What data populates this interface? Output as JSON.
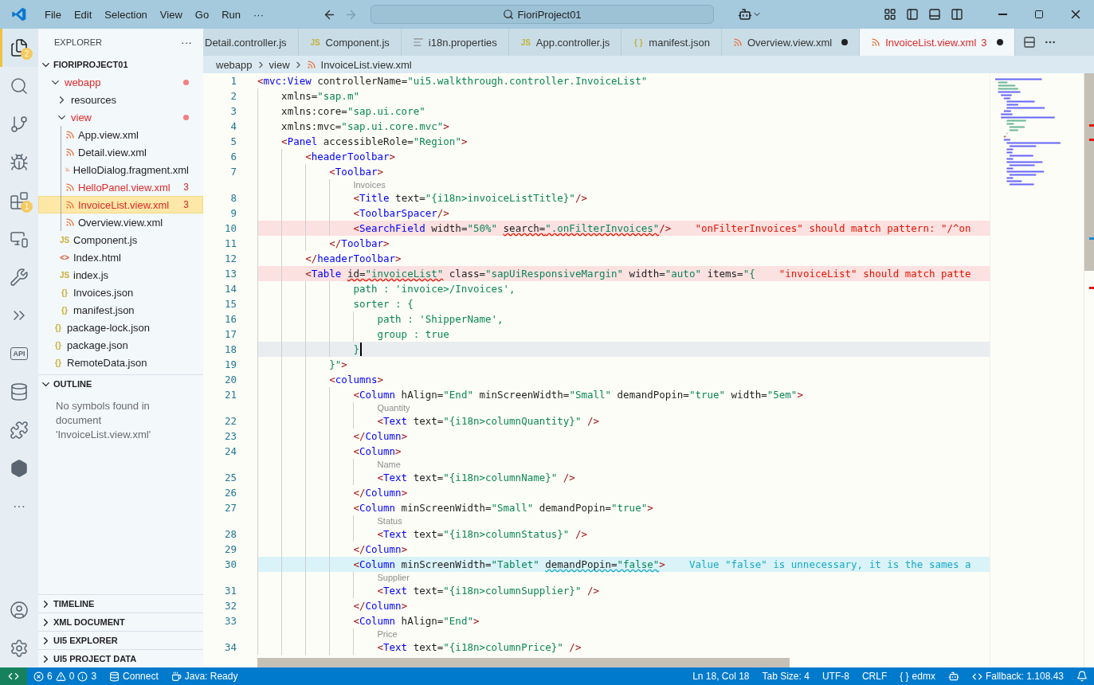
{
  "title_bar": {
    "menu": [
      "File",
      "Edit",
      "Selection",
      "View",
      "Go",
      "Run",
      "···"
    ],
    "command_center": {
      "value": "FioriProject01"
    }
  },
  "activity_bar": {
    "items": [
      {
        "kind": "files",
        "selected": true,
        "badge": "2"
      },
      {
        "kind": "search",
        "selected": false
      },
      {
        "kind": "source-control",
        "selected": false
      },
      {
        "kind": "run-debug",
        "selected": false
      },
      {
        "kind": "extensions",
        "selected": false,
        "badge": "1"
      },
      {
        "kind": "remote",
        "selected": false
      },
      {
        "kind": "tools",
        "selected": false
      },
      {
        "kind": "chevrons",
        "selected": false
      },
      {
        "kind": "api",
        "selected": false,
        "label": "API"
      },
      {
        "kind": "database",
        "selected": false
      },
      {
        "kind": "puzzle",
        "selected": false
      },
      {
        "kind": "hexagon",
        "selected": false
      },
      {
        "kind": "more",
        "selected": false,
        "label": "···"
      }
    ],
    "bottom": [
      {
        "kind": "account",
        "selected": false
      },
      {
        "kind": "settings",
        "selected": false
      }
    ]
  },
  "explorer": {
    "title": "EXPLORER",
    "more": "···",
    "project": {
      "label": "FIORIPROJECT01",
      "expanded": true,
      "children": [
        {
          "label": "webapp",
          "kind": "folder",
          "expanded": true,
          "error": true,
          "selected": false,
          "children": [
            {
              "label": "resources",
              "kind": "folder",
              "expanded": false,
              "error": false,
              "selected": false
            },
            {
              "label": "view",
              "kind": "folder",
              "expanded": true,
              "error": true,
              "selected": false,
              "children": [
                {
                  "label": "App.view.xml",
                  "kind": "xml",
                  "error": false,
                  "selected": false
                },
                {
                  "label": "Detail.view.xml",
                  "kind": "xml",
                  "error": false,
                  "selected": false
                },
                {
                  "label": "HelloDialog.fragment.xml",
                  "kind": "xml",
                  "error": false,
                  "selected": false
                },
                {
                  "label": "HelloPanel.view.xml",
                  "kind": "xml",
                  "error": true,
                  "badge": "3",
                  "selected": false
                },
                {
                  "label": "InvoiceList.view.xml",
                  "kind": "xml",
                  "error": true,
                  "badge": "3",
                  "selected": true
                },
                {
                  "label": "Overview.view.xml",
                  "kind": "xml",
                  "error": false,
                  "selected": false
                }
              ]
            },
            {
              "label": "Component.js",
              "kind": "js",
              "glyph": "JS",
              "error": false,
              "selected": false
            },
            {
              "label": "Index.html",
              "kind": "html",
              "glyph": "<>",
              "error": false,
              "selected": false
            },
            {
              "label": "index.js",
              "kind": "js",
              "glyph": "JS",
              "error": false,
              "selected": false
            },
            {
              "label": "Invoices.json",
              "kind": "json",
              "glyph": "{}",
              "error": false,
              "selected": false
            },
            {
              "label": "manifest.json",
              "kind": "json",
              "glyph": "{}",
              "error": false,
              "selected": false
            }
          ]
        },
        {
          "label": "package-lock.json",
          "kind": "json",
          "glyph": "{}",
          "error": false,
          "selected": false
        },
        {
          "label": "package.json",
          "kind": "json",
          "glyph": "{}",
          "error": false,
          "selected": false
        },
        {
          "label": "RemoteData.json",
          "kind": "json",
          "glyph": "{}",
          "error": false,
          "selected": false
        }
      ]
    }
  },
  "outline": {
    "title": "OUTLINE",
    "expanded": true,
    "message": "No symbols found in document 'InvoiceList.view.xml'"
  },
  "panels": [
    {
      "title": "TIMELINE",
      "expanded": false
    },
    {
      "title": "XML DOCUMENT",
      "expanded": false
    },
    {
      "title": "UI5 EXPLORER",
      "expanded": false
    },
    {
      "title": "UI5 PROJECT DATA",
      "expanded": false
    }
  ],
  "tabs": [
    {
      "label": "Detail.controller.js",
      "kind": "js",
      "selected": false,
      "dirty": false,
      "error": false
    },
    {
      "label": "Component.js",
      "kind": "js",
      "glyph": "JS",
      "selected": false,
      "dirty": false,
      "error": false
    },
    {
      "label": "i18n.properties",
      "kind": "properties",
      "selected": false,
      "dirty": false,
      "error": false
    },
    {
      "label": "App.controller.js",
      "kind": "js",
      "glyph": "JS",
      "selected": false,
      "dirty": false,
      "error": false
    },
    {
      "label": "manifest.json",
      "kind": "json",
      "glyph": "{ }",
      "selected": false,
      "dirty": false,
      "error": false
    },
    {
      "label": "Overview.view.xml",
      "kind": "xml",
      "selected": false,
      "dirty": true,
      "error": false
    },
    {
      "label": "InvoiceList.view.xml",
      "kind": "xml",
      "selected": true,
      "dirty": true,
      "error": true,
      "badge": "3"
    }
  ],
  "breadcrumbs": [
    {
      "label": "webapp",
      "kind": "folder"
    },
    {
      "label": "view",
      "kind": "folder"
    },
    {
      "label": "InvoiceList.view.xml",
      "kind": "xml"
    }
  ],
  "code": {
    "lines": [
      {
        "number": "1",
        "tokens": [
          {
            "kind": "punct",
            "text": "<"
          },
          {
            "kind": "tag",
            "text": "mvc:View"
          },
          {
            "kind": "attr",
            "text": " controllerName="
          },
          {
            "kind": "string",
            "text": "\"ui5.walkthrough.controller.InvoiceList\""
          }
        ]
      },
      {
        "number": "2",
        "tokens": [
          {
            "kind": "attr",
            "text": "    xmlns="
          },
          {
            "kind": "string",
            "text": "\"sap.m\""
          }
        ]
      },
      {
        "number": "3",
        "tokens": [
          {
            "kind": "attr",
            "text": "    xmlns:core="
          },
          {
            "kind": "string",
            "text": "\"sap.ui.core\""
          }
        ]
      },
      {
        "number": "4",
        "tokens": [
          {
            "kind": "attr",
            "text": "    xmlns:mvc="
          },
          {
            "kind": "string",
            "text": "\"sap.ui.core.mvc\""
          },
          {
            "kind": "punct",
            "text": ">"
          }
        ]
      },
      {
        "number": "5",
        "tokens": [
          {
            "kind": "punct",
            "text": "    <"
          },
          {
            "kind": "tag",
            "text": "Panel"
          },
          {
            "kind": "attr",
            "text": " accessibleRole="
          },
          {
            "kind": "string",
            "text": "\"Region\""
          },
          {
            "kind": "punct",
            "text": ">"
          }
        ]
      },
      {
        "number": "6",
        "tokens": [
          {
            "kind": "punct",
            "text": "        <"
          },
          {
            "kind": "tag",
            "text": "headerToolbar"
          },
          {
            "kind": "punct",
            "text": ">"
          }
        ]
      },
      {
        "number": "7",
        "tokens": [
          {
            "kind": "punct",
            "text": "            <"
          },
          {
            "kind": "tag",
            "text": "Toolbar"
          },
          {
            "kind": "punct",
            "text": ">"
          }
        ]
      },
      {
        "number": "8",
        "hint": "Invoices",
        "tokens": [
          {
            "kind": "punct",
            "text": "                <"
          },
          {
            "kind": "tag",
            "text": "Title"
          },
          {
            "kind": "attr",
            "text": " text="
          },
          {
            "kind": "string",
            "text": "\"{i18n>invoiceListTitle}\""
          },
          {
            "kind": "punct",
            "text": "/>"
          }
        ]
      },
      {
        "number": "9",
        "tokens": [
          {
            "kind": "punct",
            "text": "                <"
          },
          {
            "kind": "tag",
            "text": "ToolbarSpacer"
          },
          {
            "kind": "punct",
            "text": "/>"
          }
        ]
      },
      {
        "number": "10",
        "kind": "error",
        "tokens": [
          {
            "kind": "punct",
            "text": "                <"
          },
          {
            "kind": "tag",
            "text": "SearchField"
          },
          {
            "kind": "attr",
            "text": " width="
          },
          {
            "kind": "string",
            "text": "\"50%\" "
          },
          {
            "kind": "attr",
            "text": "search=",
            "underlined": true
          },
          {
            "kind": "string",
            "text": "\".onFilterInvoices\"",
            "underlined": true
          },
          {
            "kind": "punct",
            "text": "/>"
          }
        ],
        "diagnostic": {
          "kind": "error",
          "text": "\"onFilterInvoices\" should match pattern: \"/^on"
        }
      },
      {
        "number": "11",
        "tokens": [
          {
            "kind": "punct",
            "text": "            </"
          },
          {
            "kind": "tag",
            "text": "Toolbar"
          },
          {
            "kind": "punct",
            "text": ">"
          }
        ]
      },
      {
        "number": "12",
        "tokens": [
          {
            "kind": "punct",
            "text": "        </"
          },
          {
            "kind": "tag",
            "text": "headerToolbar"
          },
          {
            "kind": "punct",
            "text": ">"
          }
        ]
      },
      {
        "number": "13",
        "kind": "error",
        "tokens": [
          {
            "kind": "punct",
            "text": "        <"
          },
          {
            "kind": "tag",
            "text": "Table "
          },
          {
            "kind": "attr",
            "text": "id=",
            "underlined": true
          },
          {
            "kind": "string",
            "text": "\"invoiceList\"",
            "underlined": true
          },
          {
            "kind": "attr",
            "text": " class="
          },
          {
            "kind": "string",
            "text": "\"sapUiResponsiveMargin\""
          },
          {
            "kind": "attr",
            "text": " width="
          },
          {
            "kind": "string",
            "text": "\"auto\""
          },
          {
            "kind": "attr",
            "text": " items="
          },
          {
            "kind": "string",
            "text": "\"{"
          }
        ],
        "diagnostic": {
          "kind": "error",
          "text": "\"invoiceList\" should match patte"
        }
      },
      {
        "number": "14",
        "tokens": [
          {
            "kind": "string",
            "text": "                path : 'invoice>/Invoices',"
          }
        ]
      },
      {
        "number": "15",
        "tokens": [
          {
            "kind": "string",
            "text": "                sorter : {"
          }
        ]
      },
      {
        "number": "16",
        "tokens": [
          {
            "kind": "string",
            "text": "                    path : 'ShipperName',"
          }
        ]
      },
      {
        "number": "17",
        "tokens": [
          {
            "kind": "string",
            "text": "                    group : true"
          }
        ]
      },
      {
        "number": "18",
        "kind": "current",
        "cursor": true,
        "tokens": [
          {
            "kind": "string",
            "text": "                }"
          }
        ]
      },
      {
        "number": "19",
        "tokens": [
          {
            "kind": "string",
            "text": "            }\""
          },
          {
            "kind": "punct",
            "text": ">"
          }
        ]
      },
      {
        "number": "20",
        "tokens": [
          {
            "kind": "punct",
            "text": "            <"
          },
          {
            "kind": "tag",
            "text": "columns"
          },
          {
            "kind": "punct",
            "text": ">"
          }
        ]
      },
      {
        "number": "21",
        "tokens": [
          {
            "kind": "punct",
            "text": "                <"
          },
          {
            "kind": "tag",
            "text": "Column"
          },
          {
            "kind": "attr",
            "text": " hAlign="
          },
          {
            "kind": "string",
            "text": "\"End\""
          },
          {
            "kind": "attr",
            "text": " minScreenWidth="
          },
          {
            "kind": "string",
            "text": "\"Small\""
          },
          {
            "kind": "attr",
            "text": " demandPopin="
          },
          {
            "kind": "string",
            "text": "\"true\""
          },
          {
            "kind": "attr",
            "text": " width="
          },
          {
            "kind": "string",
            "text": "\"5em\""
          },
          {
            "kind": "punct",
            "text": ">"
          }
        ]
      },
      {
        "number": "22",
        "hint": "Quantity",
        "tokens": [
          {
            "kind": "punct",
            "text": "                    <"
          },
          {
            "kind": "tag",
            "text": "Text"
          },
          {
            "kind": "attr",
            "text": " text="
          },
          {
            "kind": "string",
            "text": "\"{i18n>columnQuantity}\""
          },
          {
            "kind": "punct",
            "text": " />"
          }
        ]
      },
      {
        "number": "23",
        "tokens": [
          {
            "kind": "punct",
            "text": "                </"
          },
          {
            "kind": "tag",
            "text": "Column"
          },
          {
            "kind": "punct",
            "text": ">"
          }
        ]
      },
      {
        "number": "24",
        "tokens": [
          {
            "kind": "punct",
            "text": "                <"
          },
          {
            "kind": "tag",
            "text": "Column"
          },
          {
            "kind": "punct",
            "text": ">"
          }
        ]
      },
      {
        "number": "25",
        "hint": "Name",
        "tokens": [
          {
            "kind": "punct",
            "text": "                    <"
          },
          {
            "kind": "tag",
            "text": "Text"
          },
          {
            "kind": "attr",
            "text": " text="
          },
          {
            "kind": "string",
            "text": "\"{i18n>columnName}\""
          },
          {
            "kind": "punct",
            "text": " />"
          }
        ]
      },
      {
        "number": "26",
        "tokens": [
          {
            "kind": "punct",
            "text": "                </"
          },
          {
            "kind": "tag",
            "text": "Column"
          },
          {
            "kind": "punct",
            "text": ">"
          }
        ]
      },
      {
        "number": "27",
        "tokens": [
          {
            "kind": "punct",
            "text": "                <"
          },
          {
            "kind": "tag",
            "text": "Column"
          },
          {
            "kind": "attr",
            "text": " minScreenWidth="
          },
          {
            "kind": "string",
            "text": "\"Small\""
          },
          {
            "kind": "attr",
            "text": " demandPopin="
          },
          {
            "kind": "string",
            "text": "\"true\""
          },
          {
            "kind": "punct",
            "text": ">"
          }
        ]
      },
      {
        "number": "28",
        "hint": "Status",
        "tokens": [
          {
            "kind": "punct",
            "text": "                    <"
          },
          {
            "kind": "tag",
            "text": "Text"
          },
          {
            "kind": "attr",
            "text": " text="
          },
          {
            "kind": "string",
            "text": "\"{i18n>columnStatus}\""
          },
          {
            "kind": "punct",
            "text": " />"
          }
        ]
      },
      {
        "number": "29",
        "tokens": [
          {
            "kind": "punct",
            "text": "                </"
          },
          {
            "kind": "tag",
            "text": "Column"
          },
          {
            "kind": "punct",
            "text": ">"
          }
        ]
      },
      {
        "number": "30",
        "kind": "info",
        "tokens": [
          {
            "kind": "punct",
            "text": "                <"
          },
          {
            "kind": "tag",
            "text": "Column"
          },
          {
            "kind": "attr",
            "text": " minScreenWidth="
          },
          {
            "kind": "string",
            "text": "\"Tablet\" "
          },
          {
            "kind": "attr",
            "text": "demandPopin=",
            "underlined": true
          },
          {
            "kind": "string",
            "text": "\"false\"",
            "underlined": true
          },
          {
            "kind": "punct",
            "text": ">"
          }
        ],
        "diagnostic": {
          "kind": "info",
          "text": "Value \"false\" is unnecessary, it is the sames a"
        }
      },
      {
        "number": "31",
        "hint": "Supplier",
        "tokens": [
          {
            "kind": "punct",
            "text": "                    <"
          },
          {
            "kind": "tag",
            "text": "Text"
          },
          {
            "kind": "attr",
            "text": " text="
          },
          {
            "kind": "string",
            "text": "\"{i18n>columnSupplier}\""
          },
          {
            "kind": "punct",
            "text": " />"
          }
        ]
      },
      {
        "number": "32",
        "tokens": [
          {
            "kind": "punct",
            "text": "                </"
          },
          {
            "kind": "tag",
            "text": "Column"
          },
          {
            "kind": "punct",
            "text": ">"
          }
        ]
      },
      {
        "number": "33",
        "tokens": [
          {
            "kind": "punct",
            "text": "                <"
          },
          {
            "kind": "tag",
            "text": "Column"
          },
          {
            "kind": "attr",
            "text": " hAlign="
          },
          {
            "kind": "string",
            "text": "\"End\""
          },
          {
            "kind": "punct",
            "text": ">"
          }
        ]
      },
      {
        "number": "34",
        "hint": "Price",
        "tokens": [
          {
            "kind": "punct",
            "text": "                    <"
          },
          {
            "kind": "tag",
            "text": "Text"
          },
          {
            "kind": "attr",
            "text": " text="
          },
          {
            "kind": "string",
            "text": "\"{i18n>columnPrice}\""
          },
          {
            "kind": "punct",
            "text": " />"
          }
        ]
      }
    ]
  },
  "status_bar": {
    "left": [
      {
        "kind": "remote"
      },
      {
        "kind": "problems",
        "errors": "6",
        "warnings": "0",
        "infos": "3"
      },
      {
        "kind": "connect",
        "label": "Connect"
      },
      {
        "kind": "java",
        "label": "Java: Ready"
      }
    ],
    "right": [
      {
        "kind": "text",
        "label": "Ln 18, Col 18"
      },
      {
        "kind": "text",
        "label": "Tab Size: 4"
      },
      {
        "kind": "text",
        "label": "UTF-8"
      },
      {
        "kind": "text",
        "label": "CRLF"
      },
      {
        "kind": "language",
        "glyph": "{ }",
        "label": "edmx"
      },
      {
        "kind": "copilot"
      },
      {
        "kind": "fallback",
        "label": "Fallback: 1.108.43"
      },
      {
        "kind": "bell"
      }
    ]
  }
}
